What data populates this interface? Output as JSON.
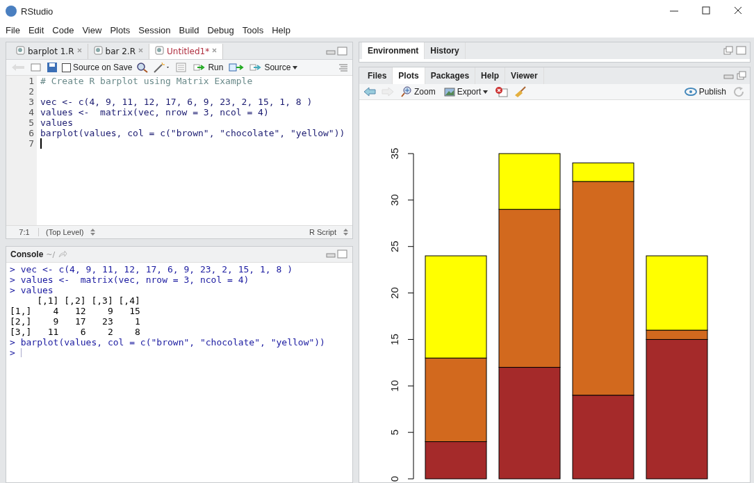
{
  "window": {
    "title": "RStudio"
  },
  "menu": [
    "File",
    "Edit",
    "Code",
    "View",
    "Plots",
    "Session",
    "Build",
    "Debug",
    "Tools",
    "Help"
  ],
  "editor": {
    "tabs": [
      {
        "label": "barplot 1.R",
        "selected": false,
        "unsaved": false
      },
      {
        "label": "bar 2.R",
        "selected": false,
        "unsaved": false
      },
      {
        "label": "Untitled1*",
        "selected": true,
        "unsaved": true
      }
    ],
    "toolbar": {
      "source_on_save": {
        "label": "Source on Save",
        "checked": false
      },
      "run": "Run",
      "source": "Source"
    },
    "lines": [
      {
        "number": "1",
        "kind": "comment",
        "text": "# Create R barplot using Matrix Example"
      },
      {
        "number": "2",
        "kind": "code"
      },
      {
        "number": "3",
        "kind": "code",
        "text": "vec <- c(4, 9, 11, 12, 17, 6, 9, 23, 2, 15, 1, 8 )"
      },
      {
        "number": "4",
        "kind": "code",
        "text": "values <-  matrix(vec, nrow = 3, ncol = 4)"
      },
      {
        "number": "5",
        "kind": "code",
        "text": "values"
      },
      {
        "number": "6",
        "kind": "code",
        "text": "barplot(values, col = c(\"brown\", \"chocolate\", \"yellow\"))"
      },
      {
        "number": "7",
        "kind": "cursor"
      }
    ],
    "status": {
      "position": "7:1",
      "scope": "(Top Level)",
      "file_type": "R Script"
    }
  },
  "console": {
    "title": "Console",
    "path": "~/",
    "lines": [
      {
        "kind": "input",
        "text": "> vec <- c(4, 9, 11, 12, 17, 6, 9, 23, 2, 15, 1, 8 )"
      },
      {
        "kind": "input",
        "text": "> values <-  matrix(vec, nrow = 3, ncol = 4)"
      },
      {
        "kind": "input",
        "text": "> values"
      },
      {
        "kind": "output",
        "text": "     [,1] [,2] [,3] [,4]"
      },
      {
        "kind": "output",
        "text": "[1,]    4   12    9   15"
      },
      {
        "kind": "output",
        "text": "[2,]    9   17   23    1"
      },
      {
        "kind": "output",
        "text": "[3,]   11    6    2    8"
      },
      {
        "kind": "input",
        "text": "> barplot(values, col = c(\"brown\", \"chocolate\", \"yellow\"))"
      },
      {
        "kind": "prompt",
        "text": ">"
      }
    ]
  },
  "environment_pane": {
    "tabs": [
      {
        "label": "Environment",
        "selected": true
      },
      {
        "label": "History",
        "selected": false
      }
    ]
  },
  "plots_pane": {
    "tabs": [
      {
        "label": "Files",
        "selected": false
      },
      {
        "label": "Plots",
        "selected": true
      },
      {
        "label": "Packages",
        "selected": false
      },
      {
        "label": "Help",
        "selected": false
      },
      {
        "label": "Viewer",
        "selected": false
      }
    ],
    "toolbar": {
      "zoom": "Zoom",
      "export": "Export",
      "publish": "Publish"
    },
    "chart_data": {
      "type": "bar",
      "stacked": true,
      "series": [
        {
          "color": "#a52a2a",
          "values": [
            4,
            12,
            9,
            15
          ]
        },
        {
          "color": "#d2691e",
          "values": [
            9,
            17,
            23,
            1
          ]
        },
        {
          "color": "#ffff00",
          "values": [
            11,
            6,
            2,
            8
          ]
        }
      ],
      "ylim": [
        0,
        35
      ],
      "yticks": [
        0,
        5,
        10,
        15,
        20,
        25,
        30,
        35
      ]
    }
  }
}
